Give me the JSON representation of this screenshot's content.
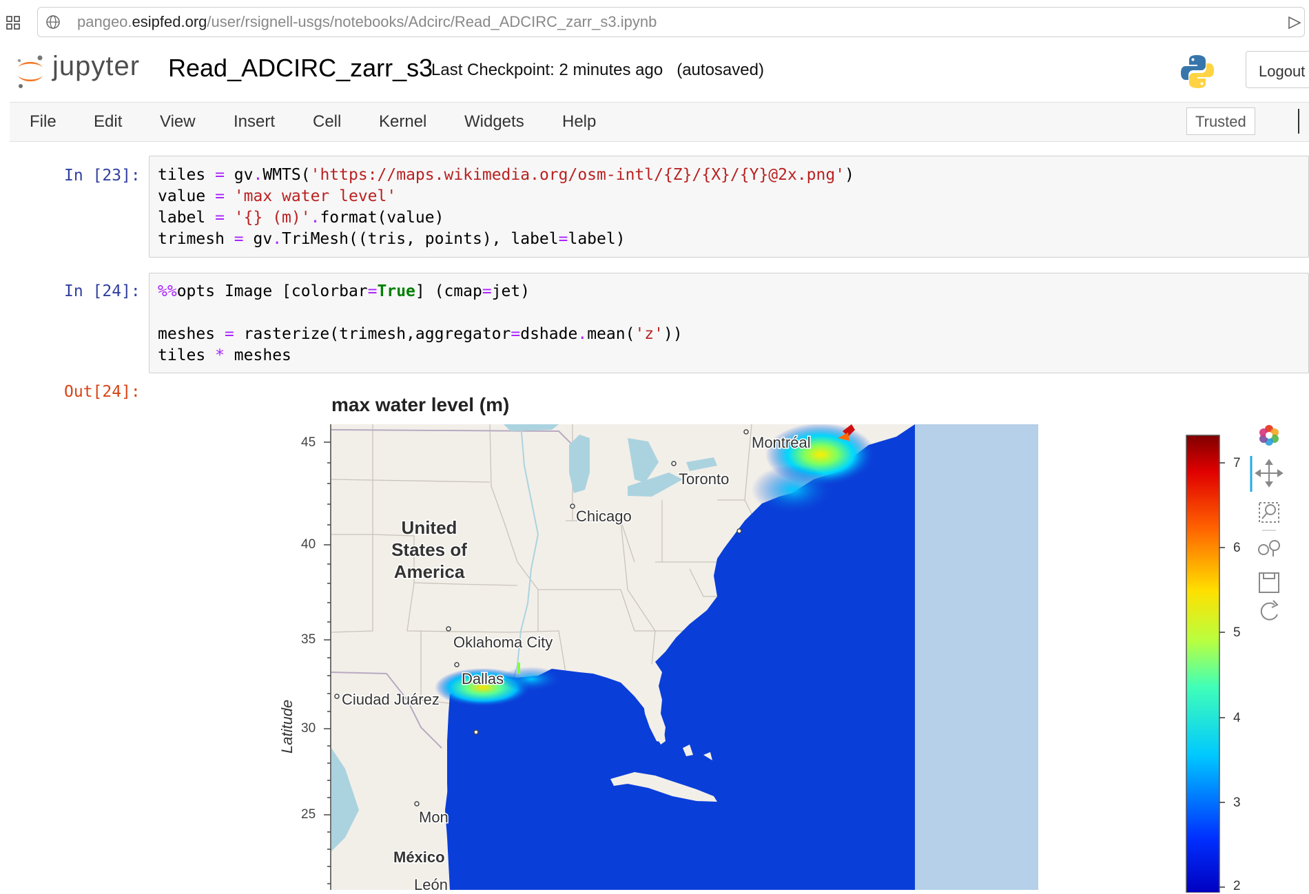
{
  "browser": {
    "url_prefix": "pangeo.",
    "url_domain": "esipfed.org",
    "url_path": "/user/rsignell-usgs/notebooks/Adcirc/Read_ADCIRC_zarr_s3.ipynb"
  },
  "header": {
    "logo_text": "jupyter",
    "notebook_title": "Read_ADCIRC_zarr_s3",
    "checkpoint": "Last Checkpoint: 2 minutes ago",
    "autosaved": "(autosaved)",
    "logout_label": "Logout"
  },
  "menubar": {
    "items": [
      "File",
      "Edit",
      "View",
      "Insert",
      "Cell",
      "Kernel",
      "Widgets",
      "Help"
    ],
    "trusted_label": "Trusted"
  },
  "cells": [
    {
      "prompt": "In [23]:",
      "lines": [
        "tiles = gv.WMTS('https://maps.wikimedia.org/osm-intl/{Z}/{X}/{Y}@2x.png')",
        "value = 'max water level'",
        "label = '{} (m)'.format(value)",
        "trimesh = gv.TriMesh((tris, points), label=label)"
      ]
    },
    {
      "prompt": "In [24]:",
      "lines": [
        "%%opts Image [colorbar=True] (cmap=jet)",
        "",
        "meshes = rasterize(trimesh,aggregator=dshade.mean('z'))",
        "tiles * meshes"
      ]
    }
  ],
  "output": {
    "prompt": "Out[24]:",
    "plot_title": "max water level (m)",
    "ylabel": "Latitude",
    "y_ticks": [
      "45",
      "40",
      "35",
      "30",
      "25"
    ],
    "colorbar_ticks": [
      "7",
      "6",
      "5",
      "4",
      "3",
      "2"
    ],
    "colormap": "jet",
    "map_labels": {
      "usa": [
        "United",
        "States of",
        "America"
      ],
      "cities": [
        "Montréal",
        "Toronto",
        "Chicago",
        "Oklahoma City",
        "Dallas",
        "Ciudad Juárez",
        "Mon",
        "México",
        "León"
      ]
    },
    "colors": {
      "ocean_mesh": "#0a3ed8",
      "land": "#f2efe9",
      "lake": "#abd3df",
      "unmeshed_ocean": "#b5d0e8"
    }
  }
}
